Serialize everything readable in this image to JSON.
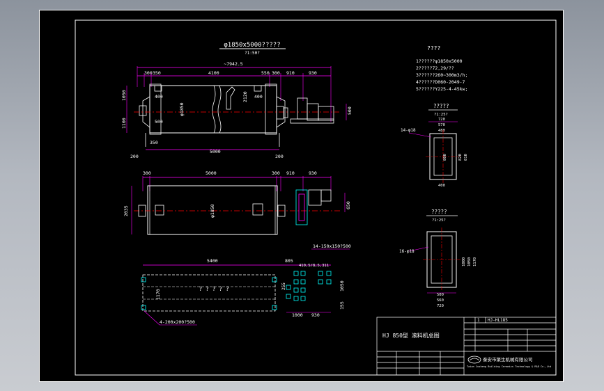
{
  "drawing": {
    "title": "φ1850x5000?????",
    "subtitle": "?1:50?",
    "dims_top": {
      "overall": "~7942.5",
      "d300a": "300",
      "d350a": "350",
      "d4100": "4100",
      "d550": "550",
      "d300b": "300",
      "d910": "910",
      "d930": "930",
      "d1050": "1050",
      "d400": "400",
      "d1100": "1100",
      "d500": "500",
      "dphi1850": "φ1850",
      "d2120": "2120",
      "d400b": "400",
      "d500r": "500",
      "d350b": "350",
      "d200": "200",
      "d5000": "5000",
      "d200b": "200"
    },
    "dims_mid": {
      "d300": "300",
      "d5000": "5000",
      "d300b": "300",
      "d910": "910",
      "d930": "930",
      "d2035": "2035",
      "dphi1850": "φ1850",
      "d650": "650"
    },
    "dims_bottom": {
      "d5400": "5400",
      "d805": "805",
      "d410": "410,5/8,5,311",
      "leader": "14-150x150?500",
      "center_text": "? ? ? ? ?",
      "d1170": "1170",
      "d1050": "1050",
      "d1000": "1000",
      "d930": "930",
      "d155": "155",
      "d255": "255",
      "anchor": "4-200x200?500"
    },
    "specs": {
      "heading": "????",
      "lines": [
        "1??????φ1850x5000",
        "2?????72,29/??",
        "3??????260~300m3/h;",
        "4??????D060-2049-7",
        "5??????Y225-4-45kw;"
      ]
    },
    "detail1": {
      "title": "?????",
      "scale": "?1:25?",
      "w1": "720",
      "w2": "570",
      "w3": "480",
      "h1": "800",
      "h2": "820",
      "h3": "810",
      "bottom": "400",
      "holes": "14-φ18"
    },
    "detail2": {
      "title": "?????",
      "scale": "?1:25?",
      "holes": "16-φ18",
      "h1": "1000",
      "h2": "1050",
      "h3": "1170",
      "b1": "500",
      "b2": "560",
      "b3": "720"
    },
    "title_block": {
      "drawing_name": "HJ 850型 滚料机总图",
      "code_label": "1",
      "code": "HJ-HL185",
      "company_cn": "泰安市聚生机械有限公司",
      "company_en": "Taian Jusheng Building Ceramics Technology & R&D Co.,Ltd"
    },
    "colors": {
      "background": "#000000",
      "line": "#ffffff",
      "dimension": "#ff00ff",
      "center": "#ff0000",
      "text": "#ffffff",
      "hatch": "#00ffff",
      "motor": "#00ffff"
    }
  }
}
